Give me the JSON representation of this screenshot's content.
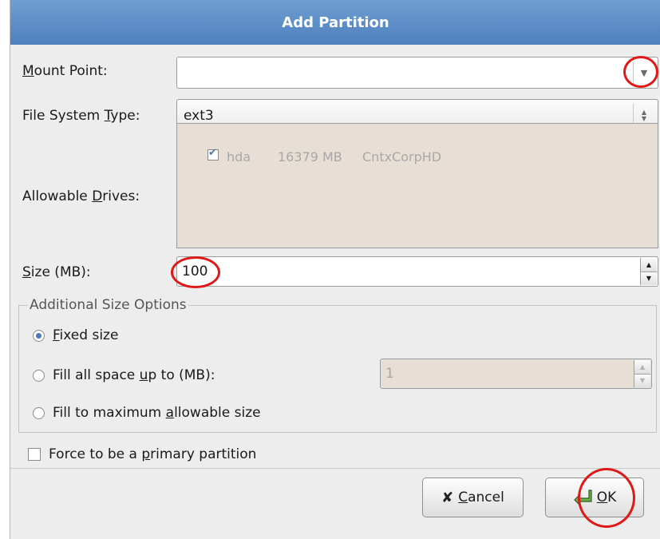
{
  "window": {
    "title": "Add Partition"
  },
  "fields": {
    "mount_point": {
      "label_mn": "M",
      "label_rest": "ount Point:",
      "value": ""
    },
    "fs_type": {
      "label_pre": "File System ",
      "label_mn": "T",
      "label_rest": "ype:",
      "value": "ext3"
    },
    "drives": {
      "label_pre": "Allowable ",
      "label_mn": "D",
      "label_rest": "rives:",
      "items": [
        {
          "name": "hda",
          "size": "16379 MB",
          "model": "CntxCorpHD",
          "checked": true
        }
      ]
    },
    "size": {
      "label_mn": "S",
      "label_rest": "ize (MB):",
      "value": "100"
    }
  },
  "size_options": {
    "legend": "Additional Size Options",
    "fixed": {
      "label_mn": "F",
      "label_rest": "ixed size",
      "selected": true
    },
    "fill_upto": {
      "label_pre": "Fill all space ",
      "label_mn": "u",
      "label_rest": "p to (MB):",
      "value": "1",
      "selected": false
    },
    "fill_max": {
      "label_pre": "Fill to maximum ",
      "label_mn": "a",
      "label_rest": "llowable size",
      "selected": false
    }
  },
  "primary": {
    "label_pre": "Force to be a ",
    "label_mn": "p",
    "label_rest": "rimary partition",
    "checked": false
  },
  "buttons": {
    "cancel": {
      "label_mn": "C",
      "label_rest": "ancel"
    },
    "ok": {
      "label_mn": "O",
      "label_rest": "K"
    }
  },
  "colors": {
    "title_bar": "#5a8bc8",
    "highlight_circle": "#e01818"
  }
}
